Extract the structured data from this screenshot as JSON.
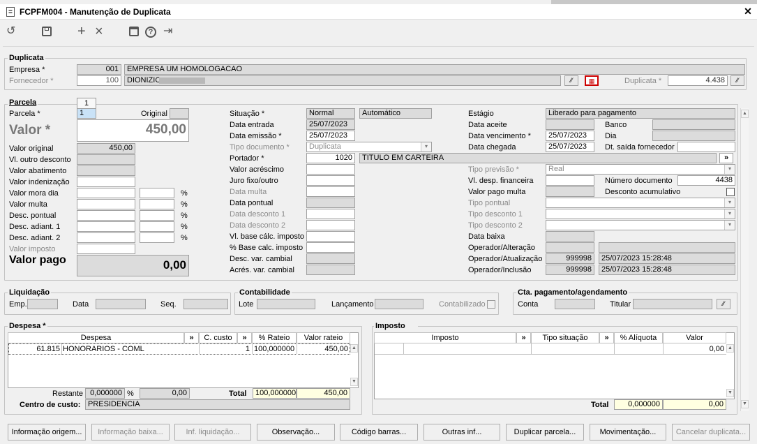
{
  "window": {
    "title": "FCPFM004 - Manutenção de Duplicata",
    "close": "✕"
  },
  "toolbar": {
    "undo": "↺",
    "save": "🖫",
    "add": "+",
    "remove": "×",
    "calendar": "📅",
    "help": "?",
    "exit": "⇥"
  },
  "duplicata": {
    "section": "Duplicata",
    "empresa_label": "Empresa *",
    "empresa_code": "001",
    "empresa_name": "EMPRESA UM HOMOLOGACAO",
    "fornecedor_label": "Fornecedor *",
    "fornecedor_code": "100",
    "fornecedor_name": "DIONIZIO",
    "duplicata_label": "Duplicata *",
    "duplicata_value": "4.438"
  },
  "parcela": {
    "section": "Parcela",
    "tab": "1",
    "parcela_label": "Parcela *",
    "parcela_value": "1",
    "original_label": "Original",
    "valor_label": "Valor *",
    "valor": "450,00",
    "left": [
      {
        "label": "Valor original",
        "value": "450,00",
        "pct": null
      },
      {
        "label": "Vl. outro desconto",
        "value": "",
        "pct": null
      },
      {
        "label": "Valor abatimento",
        "value": "",
        "pct": null
      },
      {
        "label": "Valor indenização",
        "value": "",
        "pct": null
      },
      {
        "label": "Valor mora dia",
        "value": "",
        "pct": "%"
      },
      {
        "label": "Valor multa",
        "value": "",
        "pct": "%"
      },
      {
        "label": "Desc. pontual",
        "value": "",
        "pct": "%"
      },
      {
        "label": "Desc. adiant. 1",
        "value": "",
        "pct": "%"
      },
      {
        "label": "Desc. adiant. 2",
        "value": "",
        "pct": "%"
      },
      {
        "label": "Valor imposto",
        "value": "",
        "pct": null
      }
    ],
    "valor_pago_label": "Valor pago",
    "valor_pago": "0,00",
    "situacao_label": "Situação *",
    "situacao": "Normal",
    "situacao_tipo": "Automático",
    "data_entrada_label": "Data entrada",
    "data_entrada": "25/07/2023",
    "data_emissao_label": "Data emissão *",
    "data_emissao": "25/07/2023",
    "tipo_documento_label": "Tipo documento *",
    "tipo_documento": "Duplicata",
    "portador_label": "Portador *",
    "portador_code": "1020",
    "portador_name": "TITULO EM CARTEIRA",
    "mid": [
      "Valor acréscimo",
      "Juro fixo/outro",
      "Data multa",
      "Data pontual",
      "Data desconto 1",
      "Data desconto 2",
      "Vl. base cálc. imposto",
      "% Base calc. imposto",
      "Desc. var. cambial",
      "Acrés. var. cambial"
    ],
    "estagio_label": "Estágio",
    "estagio": "Liberado para pagamento",
    "data_aceite_label": "Data aceite",
    "banco_label": "Banco",
    "data_vencimento_label": "Data vencimento *",
    "data_vencimento": "25/07/2023",
    "dia_label": "Dia",
    "data_chegada_label": "Data chegada",
    "data_chegada": "25/07/2023",
    "dt_saida_label": "Dt. saída fornecedor",
    "tipo_previsao_label": "Tipo previsão *",
    "tipo_previsao": "Real",
    "vl_desp_label": "Vl. desp. financeira",
    "numero_documento_label": "Número documento",
    "numero_documento": "4438",
    "valor_pago_multa_label": "Valor pago multa",
    "desconto_acumulativo_label": "Desconto acumulativo",
    "tipo_pontual_label": "Tipo pontual",
    "tipo_desconto1_label": "Tipo desconto 1",
    "tipo_desconto2_label": "Tipo desconto 2",
    "data_baixa_label": "Data baixa",
    "operador_alteracao_label": "Operador/Alteração",
    "operador_atualizacao_label": "Operador/Atualização",
    "operador_atualizacao": "999998",
    "operador_atualizacao_data": "25/07/2023 15:28:48",
    "operador_inclusao_label": "Operador/Inclusão",
    "operador_inclusao": "999998",
    "operador_inclusao_data": "25/07/2023 15:28:48"
  },
  "liquidacao": {
    "section": "Liquidação",
    "emp_label": "Emp.",
    "data_label": "Data",
    "seq_label": "Seq."
  },
  "contabilidade": {
    "section": "Contabilidade",
    "lote_label": "Lote",
    "lancamento_label": "Lançamento",
    "contabilizado_label": "Contabilizado"
  },
  "cta": {
    "section": "Cta. pagamento/agendamento",
    "conta_label": "Conta",
    "titular_label": "Titular"
  },
  "despesa": {
    "section": "Despesa *",
    "cols": [
      "Despesa",
      "»",
      "C. custo",
      "»",
      "% Rateio",
      "Valor rateio"
    ],
    "rows": [
      {
        "codigo": "61.815",
        "nome": "HONORARIOS - COML",
        "ccusto": "1",
        "rateio": "100,000000",
        "valor": "450,00"
      }
    ],
    "restante_label": "Restante",
    "restante_pct": "0,000000",
    "pct_sign": "%",
    "restante_valor": "0,00",
    "total_label": "Total",
    "total_pct": "100,000000",
    "total_valor": "450,00",
    "centro_label": "Centro de custo:",
    "centro_value": "PRESIDENCIA"
  },
  "imposto": {
    "section": "Imposto",
    "cols": [
      "Imposto",
      "»",
      "Tipo situação",
      "»",
      "% Alíquota",
      "Valor"
    ],
    "row_valor": "0,00",
    "total_label": "Total",
    "total_pct": "0,000000",
    "total_valor": "0,00"
  },
  "buttons": [
    "Informação origem...",
    "Informação baixa...",
    "Inf. liquidação...",
    "Observação...",
    "Código barras...",
    "Outras inf...",
    "Duplicar parcela...",
    "Movimentação...",
    "Cancelar duplicata..."
  ]
}
